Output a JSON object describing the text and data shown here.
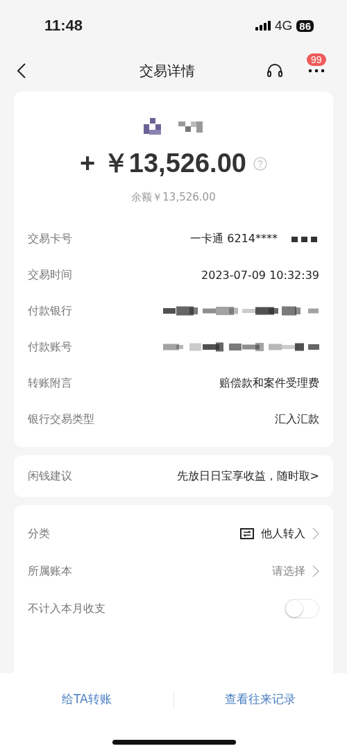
{
  "status_bar": {
    "time": "11:48",
    "network": "4G",
    "battery": "86"
  },
  "nav": {
    "title": "交易详情",
    "badge": "99"
  },
  "summary": {
    "amount": "+ ￥13,526.00",
    "balance": "余额￥13,526.00"
  },
  "details": [
    {
      "label": "交易卡号",
      "value": "一卡通 6214****",
      "redacted": true
    },
    {
      "label": "交易时间",
      "value": "2023-07-09 10:32:39",
      "redacted": false
    },
    {
      "label": "付款银行",
      "redacted": true
    },
    {
      "label": "付款账号",
      "redacted": true
    },
    {
      "label": "转账附言",
      "value": "赔偿款和案件受理费",
      "redacted": false
    },
    {
      "label": "银行交易类型",
      "value": "汇入汇款",
      "redacted": false
    }
  ],
  "tip": {
    "label": "闲钱建议",
    "text": "先放日日宝享收益，随时取>"
  },
  "settings": [
    {
      "kind": "link",
      "label": "分类",
      "value": "他人转入",
      "icon": true
    },
    {
      "kind": "link",
      "label": "所属账本",
      "value": "请选择",
      "placeholder": true
    },
    {
      "kind": "toggle",
      "label": "不计入本月收支",
      "on": false
    }
  ],
  "bottom_actions": [
    "给TA转账",
    "查看往来记录"
  ]
}
